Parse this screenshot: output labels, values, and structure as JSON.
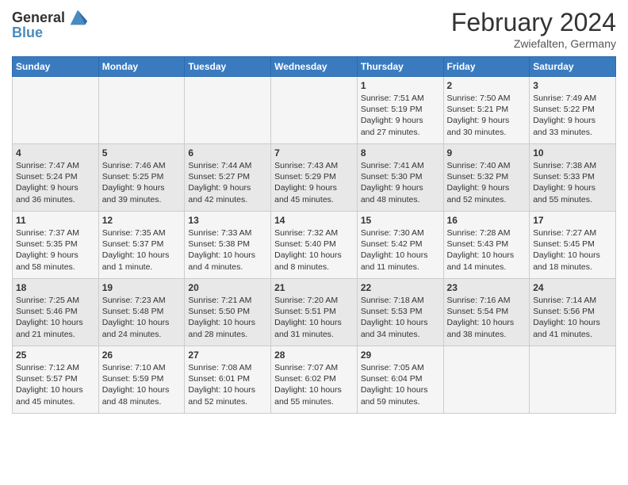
{
  "header": {
    "logo_line1": "General",
    "logo_line2": "Blue",
    "month_title": "February 2024",
    "location": "Zwiefalten, Germany"
  },
  "weekdays": [
    "Sunday",
    "Monday",
    "Tuesday",
    "Wednesday",
    "Thursday",
    "Friday",
    "Saturday"
  ],
  "weeks": [
    [
      {
        "day": "",
        "info": ""
      },
      {
        "day": "",
        "info": ""
      },
      {
        "day": "",
        "info": ""
      },
      {
        "day": "",
        "info": ""
      },
      {
        "day": "1",
        "info": "Sunrise: 7:51 AM\nSunset: 5:19 PM\nDaylight: 9 hours\nand 27 minutes."
      },
      {
        "day": "2",
        "info": "Sunrise: 7:50 AM\nSunset: 5:21 PM\nDaylight: 9 hours\nand 30 minutes."
      },
      {
        "day": "3",
        "info": "Sunrise: 7:49 AM\nSunset: 5:22 PM\nDaylight: 9 hours\nand 33 minutes."
      }
    ],
    [
      {
        "day": "4",
        "info": "Sunrise: 7:47 AM\nSunset: 5:24 PM\nDaylight: 9 hours\nand 36 minutes."
      },
      {
        "day": "5",
        "info": "Sunrise: 7:46 AM\nSunset: 5:25 PM\nDaylight: 9 hours\nand 39 minutes."
      },
      {
        "day": "6",
        "info": "Sunrise: 7:44 AM\nSunset: 5:27 PM\nDaylight: 9 hours\nand 42 minutes."
      },
      {
        "day": "7",
        "info": "Sunrise: 7:43 AM\nSunset: 5:29 PM\nDaylight: 9 hours\nand 45 minutes."
      },
      {
        "day": "8",
        "info": "Sunrise: 7:41 AM\nSunset: 5:30 PM\nDaylight: 9 hours\nand 48 minutes."
      },
      {
        "day": "9",
        "info": "Sunrise: 7:40 AM\nSunset: 5:32 PM\nDaylight: 9 hours\nand 52 minutes."
      },
      {
        "day": "10",
        "info": "Sunrise: 7:38 AM\nSunset: 5:33 PM\nDaylight: 9 hours\nand 55 minutes."
      }
    ],
    [
      {
        "day": "11",
        "info": "Sunrise: 7:37 AM\nSunset: 5:35 PM\nDaylight: 9 hours\nand 58 minutes."
      },
      {
        "day": "12",
        "info": "Sunrise: 7:35 AM\nSunset: 5:37 PM\nDaylight: 10 hours\nand 1 minute."
      },
      {
        "day": "13",
        "info": "Sunrise: 7:33 AM\nSunset: 5:38 PM\nDaylight: 10 hours\nand 4 minutes."
      },
      {
        "day": "14",
        "info": "Sunrise: 7:32 AM\nSunset: 5:40 PM\nDaylight: 10 hours\nand 8 minutes."
      },
      {
        "day": "15",
        "info": "Sunrise: 7:30 AM\nSunset: 5:42 PM\nDaylight: 10 hours\nand 11 minutes."
      },
      {
        "day": "16",
        "info": "Sunrise: 7:28 AM\nSunset: 5:43 PM\nDaylight: 10 hours\nand 14 minutes."
      },
      {
        "day": "17",
        "info": "Sunrise: 7:27 AM\nSunset: 5:45 PM\nDaylight: 10 hours\nand 18 minutes."
      }
    ],
    [
      {
        "day": "18",
        "info": "Sunrise: 7:25 AM\nSunset: 5:46 PM\nDaylight: 10 hours\nand 21 minutes."
      },
      {
        "day": "19",
        "info": "Sunrise: 7:23 AM\nSunset: 5:48 PM\nDaylight: 10 hours\nand 24 minutes."
      },
      {
        "day": "20",
        "info": "Sunrise: 7:21 AM\nSunset: 5:50 PM\nDaylight: 10 hours\nand 28 minutes."
      },
      {
        "day": "21",
        "info": "Sunrise: 7:20 AM\nSunset: 5:51 PM\nDaylight: 10 hours\nand 31 minutes."
      },
      {
        "day": "22",
        "info": "Sunrise: 7:18 AM\nSunset: 5:53 PM\nDaylight: 10 hours\nand 34 minutes."
      },
      {
        "day": "23",
        "info": "Sunrise: 7:16 AM\nSunset: 5:54 PM\nDaylight: 10 hours\nand 38 minutes."
      },
      {
        "day": "24",
        "info": "Sunrise: 7:14 AM\nSunset: 5:56 PM\nDaylight: 10 hours\nand 41 minutes."
      }
    ],
    [
      {
        "day": "25",
        "info": "Sunrise: 7:12 AM\nSunset: 5:57 PM\nDaylight: 10 hours\nand 45 minutes."
      },
      {
        "day": "26",
        "info": "Sunrise: 7:10 AM\nSunset: 5:59 PM\nDaylight: 10 hours\nand 48 minutes."
      },
      {
        "day": "27",
        "info": "Sunrise: 7:08 AM\nSunset: 6:01 PM\nDaylight: 10 hours\nand 52 minutes."
      },
      {
        "day": "28",
        "info": "Sunrise: 7:07 AM\nSunset: 6:02 PM\nDaylight: 10 hours\nand 55 minutes."
      },
      {
        "day": "29",
        "info": "Sunrise: 7:05 AM\nSunset: 6:04 PM\nDaylight: 10 hours\nand 59 minutes."
      },
      {
        "day": "",
        "info": ""
      },
      {
        "day": "",
        "info": ""
      }
    ]
  ]
}
